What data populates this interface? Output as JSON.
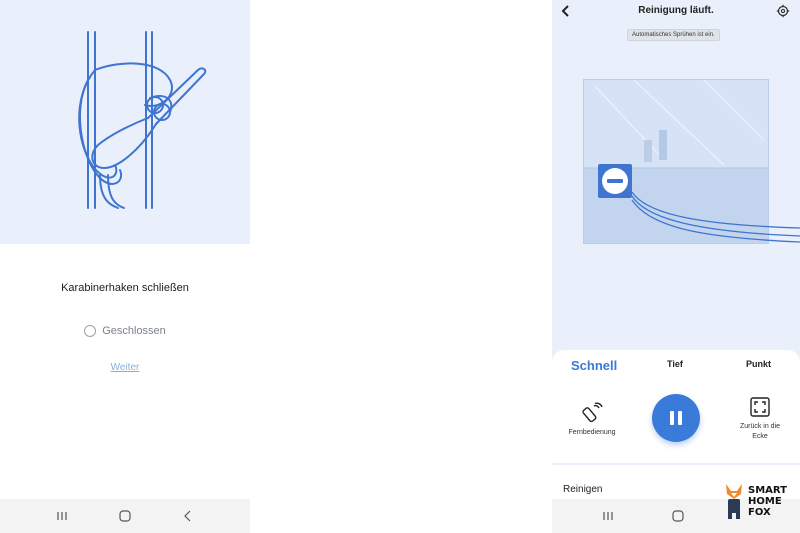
{
  "left_screen": {
    "step_title": "Karabinerhaken schließen",
    "checkbox_label": "Geschlossen",
    "next_label": "Weiter"
  },
  "right_screen": {
    "title": "Reinigung läuft.",
    "toast": "Automatisches Sprühen ist ein.",
    "modes": [
      {
        "label": "Schnell",
        "active": true
      },
      {
        "label": "Tief",
        "active": false
      },
      {
        "label": "Punkt",
        "active": false
      }
    ],
    "remote_label": "Fernbedienung",
    "return_label_line1": "Zurück in die",
    "return_label_line2": "Ecke",
    "section_label": "Reinigen"
  },
  "watermark": {
    "line1": "SMART",
    "line2": "HOME",
    "line3": "FOX"
  },
  "icons": {
    "back": "chevron-left-icon",
    "settings": "gear-icon",
    "remote": "remote-control-icon",
    "return_corner": "expand-corners-icon",
    "pause": "pause-icon",
    "nav_recent": "recent-apps-icon",
    "nav_home": "home-icon",
    "nav_back": "chevron-left-icon"
  },
  "colors": {
    "accent": "#3a7ad9",
    "illustration_bg": "#e9f0fb",
    "rope": "#3f75d1",
    "link": "#8ab0d6"
  }
}
